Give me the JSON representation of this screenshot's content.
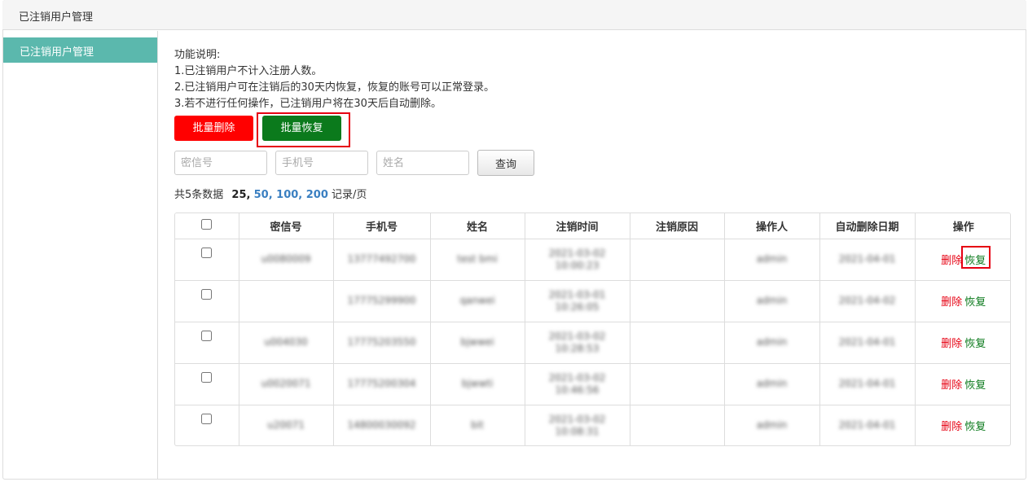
{
  "header": {
    "title": "已注销用户管理"
  },
  "sidebar": {
    "items": [
      {
        "label": "已注销用户管理"
      }
    ]
  },
  "description": {
    "heading": "功能说明:",
    "lines": [
      "1.已注销用户不计入注册人数。",
      "2.已注销用户可在注销后的30天内恢复，恢复的账号可以正常登录。",
      "3.若不进行任何操作，已注销用户将在30天后自动删除。"
    ]
  },
  "buttons": {
    "batch_delete": "批量删除",
    "batch_restore": "批量恢复",
    "query": "查询"
  },
  "filters": {
    "secret_id_placeholder": "密信号",
    "phone_placeholder": "手机号",
    "name_placeholder": "姓名"
  },
  "summary": {
    "total_text": "共5条数据",
    "current_page_size": "25,",
    "page_sizes": [
      "50",
      "100",
      "200"
    ],
    "unit": "记录/页"
  },
  "table": {
    "columns": [
      "密信号",
      "手机号",
      "姓名",
      "注销时间",
      "注销原因",
      "操作人",
      "自动删除日期",
      "操作"
    ],
    "rows": [
      {
        "secret_id": "u0080009",
        "phone": "13777492700",
        "name": "test bmi",
        "time_date": "2021-03-02",
        "time_clock": "10:00:23",
        "reason": "",
        "operator": "admin",
        "delete_date": "2021-04-01"
      },
      {
        "secret_id": "",
        "phone": "17775299900",
        "name": "qanwei",
        "time_date": "2021-03-01",
        "time_clock": "10:26:05",
        "reason": "",
        "operator": "admin",
        "delete_date": "2021-04-02"
      },
      {
        "secret_id": "u004030",
        "phone": "17775203550",
        "name": "bjwwei",
        "time_date": "2021-03-02",
        "time_clock": "10:28:53",
        "reason": "",
        "operator": "admin",
        "delete_date": "2021-04-01"
      },
      {
        "secret_id": "u0020071",
        "phone": "17775200304",
        "name": "bjwwti",
        "time_date": "2021-03-02",
        "time_clock": "10:46:56",
        "reason": "",
        "operator": "admin",
        "delete_date": "2021-04-01"
      },
      {
        "secret_id": "u20071",
        "phone": "14800030092",
        "name": "bit",
        "time_date": "2021-03-02",
        "time_clock": "10:08:31",
        "reason": "",
        "operator": "admin",
        "delete_date": "2021-04-01"
      }
    ],
    "action_delete": "删除",
    "action_restore": "恢复"
  }
}
